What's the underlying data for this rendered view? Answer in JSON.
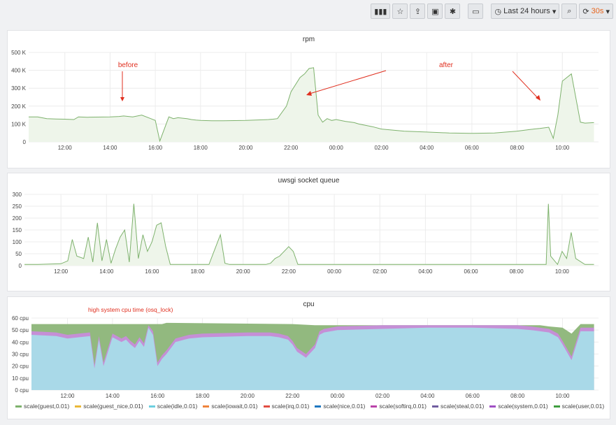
{
  "toolbar": {
    "time_range": "Last 24 hours",
    "refresh": "30s",
    "icons": [
      "add-panel-icon",
      "star-icon",
      "share-icon",
      "save-icon",
      "gear-icon",
      "tv-icon",
      "clock-icon",
      "zoom-out-icon",
      "refresh-icon"
    ]
  },
  "colors": {
    "green": "#7eb26d",
    "fill": "#eef5ea",
    "annotation": "#e02f1f",
    "idle": "#a9d9e8",
    "system": "#c58fd6"
  },
  "chart_data": [
    {
      "type": "area",
      "title": "rpm",
      "x_ticks": [
        "12:00",
        "14:00",
        "16:00",
        "18:00",
        "20:00",
        "22:00",
        "00:00",
        "02:00",
        "04:00",
        "06:00",
        "08:00",
        "10:00"
      ],
      "y_ticks": [
        "0",
        "100 K",
        "200 K",
        "300 K",
        "400 K",
        "500 K"
      ],
      "ylim": [
        0,
        500000
      ],
      "series": [
        {
          "x": [
            -1.6,
            -1.2,
            -0.8,
            -0.4,
            0,
            0.4,
            0.6,
            1,
            2,
            2.4,
            2.6,
            3,
            3.4,
            3.8,
            4,
            4.2,
            4.6,
            4.8,
            5,
            5.4,
            5.6,
            5.8,
            6,
            6.5,
            7,
            8,
            9,
            9.2,
            9.4,
            9.8,
            10,
            10.4,
            10.6,
            10.8,
            11,
            11.2,
            11.4,
            11.6,
            11.8,
            12,
            12.4,
            12.8,
            13,
            13.6,
            14,
            15,
            16,
            17,
            18,
            19,
            20,
            20.6,
            21,
            21.4,
            21.6,
            21.8,
            22,
            22.4,
            22.8,
            23,
            23.4
          ],
          "values": [
            140000,
            140000,
            130000,
            128000,
            127000,
            125000,
            140000,
            138000,
            140000,
            142000,
            145000,
            140000,
            150000,
            130000,
            120000,
            5000,
            140000,
            130000,
            135000,
            130000,
            125000,
            122000,
            120000,
            118000,
            118000,
            120000,
            125000,
            127000,
            130000,
            200000,
            280000,
            360000,
            380000,
            410000,
            415000,
            150000,
            110000,
            130000,
            120000,
            125000,
            115000,
            108000,
            100000,
            85000,
            72000,
            60000,
            55000,
            50000,
            48000,
            50000,
            60000,
            70000,
            75000,
            82000,
            20000,
            150000,
            340000,
            380000,
            110000,
            105000,
            108000
          ]
        }
      ],
      "annotations": [
        "before",
        "after"
      ]
    },
    {
      "type": "line",
      "title": "uwsgi socket queue",
      "x_ticks": [
        "12:00",
        "14:00",
        "16:00",
        "18:00",
        "20:00",
        "22:00",
        "00:00",
        "02:00",
        "04:00",
        "06:00",
        "08:00",
        "10:00"
      ],
      "y_ticks": [
        "0",
        "50",
        "100",
        "150",
        "200",
        "250",
        "300"
      ],
      "ylim": [
        0,
        300
      ],
      "series": [
        {
          "x": [
            -1.6,
            -1,
            0,
            0.3,
            0.5,
            0.7,
            1,
            1.2,
            1.4,
            1.6,
            1.8,
            2,
            2.2,
            2.4,
            2.6,
            2.8,
            3,
            3.2,
            3.4,
            3.6,
            3.8,
            4,
            4.2,
            4.4,
            4.6,
            4.8,
            5,
            5.2,
            5.4,
            5.6,
            6,
            6.5,
            7,
            7.2,
            7.4,
            8,
            9,
            9.2,
            9.4,
            9.6,
            10,
            10.2,
            10.4,
            11,
            12,
            14,
            16,
            18,
            20,
            21,
            21.3,
            21.4,
            21.5,
            21.8,
            22,
            22.2,
            22.4,
            22.6,
            23,
            23.4
          ],
          "values": [
            5,
            5,
            8,
            20,
            110,
            40,
            30,
            120,
            15,
            180,
            20,
            110,
            10,
            70,
            120,
            150,
            15,
            260,
            30,
            130,
            60,
            100,
            170,
            180,
            80,
            5,
            5,
            5,
            5,
            5,
            5,
            5,
            130,
            10,
            5,
            5,
            5,
            10,
            30,
            40,
            80,
            60,
            5,
            5,
            5,
            5,
            5,
            5,
            5,
            5,
            5,
            260,
            40,
            5,
            60,
            30,
            140,
            30,
            5,
            5
          ]
        }
      ]
    },
    {
      "type": "area",
      "title": "cpu",
      "x_ticks": [
        "12:00",
        "14:00",
        "16:00",
        "18:00",
        "20:00",
        "22:00",
        "00:00",
        "02:00",
        "04:00",
        "06:00",
        "08:00",
        "10:00"
      ],
      "y_ticks": [
        "0 cpu",
        "10 cpu",
        "20 cpu",
        "30 cpu",
        "40 cpu",
        "50 cpu",
        "60 cpu"
      ],
      "ylim": [
        0,
        60
      ],
      "idle": {
        "x": [
          -1.6,
          -0.5,
          0,
          0.5,
          1,
          1.2,
          1.4,
          1.6,
          2,
          2.4,
          2.6,
          2.8,
          3,
          3.2,
          3.4,
          3.6,
          3.8,
          4,
          4.2,
          4.4,
          4.6,
          4.8,
          5,
          5.2,
          5.4,
          6,
          8,
          9,
          9.4,
          9.8,
          10,
          10.2,
          10.6,
          11,
          11.2,
          11.4,
          12,
          14,
          16,
          18,
          20,
          20.6,
          21,
          21.4,
          21.8,
          22,
          22.4,
          22.8,
          23,
          23.4
        ],
        "values": [
          46,
          45,
          43,
          44,
          45,
          18,
          42,
          20,
          44,
          40,
          42,
          38,
          35,
          41,
          36,
          52,
          46,
          20,
          26,
          30,
          35,
          40,
          41,
          42,
          43,
          44,
          45,
          45,
          44,
          42,
          38,
          32,
          27,
          35,
          46,
          48,
          50,
          51,
          52,
          52,
          51,
          50,
          49,
          48,
          44,
          38,
          25,
          49,
          49,
          49
        ]
      },
      "total": {
        "x": [
          -1.6,
          4,
          4.2,
          4.4,
          10,
          11,
          20,
          21,
          21.4,
          22,
          22.4,
          22.8,
          23.4
        ],
        "values": [
          55,
          55,
          55,
          56,
          55,
          54,
          54,
          54,
          53,
          52,
          47,
          55,
          55
        ]
      },
      "annotation": "high system cpu time (osq_lock)",
      "legend": [
        "scale(guest,0.01)",
        "scale(guest_nice,0.01)",
        "scale(idle,0.01)",
        "scale(iowait,0.01)",
        "scale(irq,0.01)",
        "scale(nice,0.01)",
        "scale(softirq,0.01)",
        "scale(steal,0.01)",
        "scale(system,0.01)",
        "scale(user,0.01)"
      ],
      "legend_colors": [
        "#7eb26d",
        "#eab839",
        "#6ed0e0",
        "#ef843c",
        "#e24d42",
        "#1f78c1",
        "#ba43a9",
        "#705da0",
        "#a050c4",
        "#3f9e3f"
      ]
    }
  ]
}
